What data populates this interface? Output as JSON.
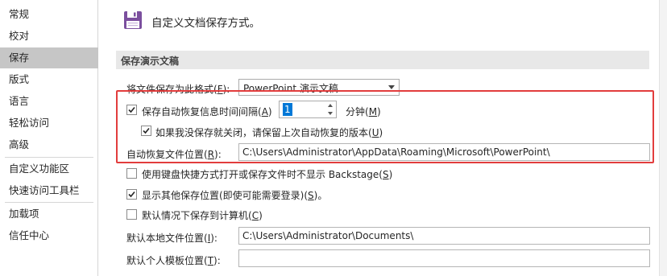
{
  "sidebar": {
    "items": [
      {
        "label": "常规"
      },
      {
        "label": "校对"
      },
      {
        "label": "保存",
        "active": true
      },
      {
        "label": "版式"
      },
      {
        "label": "语言"
      },
      {
        "label": "轻松访问"
      },
      {
        "label": "高级"
      },
      {
        "label": "自定义功能区"
      },
      {
        "label": "快速访问工具栏"
      },
      {
        "label": "加载项"
      },
      {
        "label": "信任中心"
      }
    ]
  },
  "header": {
    "icon": "save-disk-icon",
    "title": "自定义文档保存方式。"
  },
  "section": {
    "title": "保存演示文稿"
  },
  "format": {
    "label": "将文件保存为此格式(F):",
    "label_prefix": "将文件保存为此格式(",
    "label_key": "F",
    "label_suffix": "):",
    "value": "PowerPoint 演示文稿"
  },
  "autorecover": {
    "checked": true,
    "label_prefix": "保存自动恢复信息时间间隔(",
    "label_key": "A",
    "label_suffix": ")",
    "interval_value": "1",
    "unit_prefix": "分钟(",
    "unit_key": "M",
    "unit_suffix": ")"
  },
  "keep_last": {
    "checked": true,
    "label_prefix": "如果我没保存就关闭，请保留上次自动恢复的版本(",
    "label_key": "U",
    "label_suffix": ")"
  },
  "autorecover_location": {
    "label_prefix": "自动恢复文件位置(",
    "label_key": "R",
    "label_suffix": "):",
    "value": "C:\\Users\\Administrator\\AppData\\Roaming\\Microsoft\\PowerPoint\\"
  },
  "no_backstage": {
    "checked": false,
    "label_prefix": "使用键盘快捷方式打开或保存文件时不显示 Backstage(",
    "label_key": "S",
    "label_suffix": ")"
  },
  "show_more_locations": {
    "checked": true,
    "label_prefix": "显示其他保存位置(即使可能需要登录)(",
    "label_key": "S",
    "label_suffix": ")。"
  },
  "save_to_computer": {
    "checked": false,
    "label_prefix": "默认情况下保存到计算机(",
    "label_key": "C",
    "label_suffix": ")"
  },
  "local_location": {
    "label_prefix": "默认本地文件位置(",
    "label_key": "I",
    "label_suffix": "):",
    "value": "C:\\Users\\Administrator\\Documents\\"
  },
  "template_location": {
    "label_prefix": "默认个人模板位置(",
    "label_key": "T",
    "label_suffix": "):",
    "value": ""
  },
  "colors": {
    "accent_purple": "#7b4f9e",
    "highlight_red": "#e23d3d",
    "selection_blue": "#0078d7"
  }
}
